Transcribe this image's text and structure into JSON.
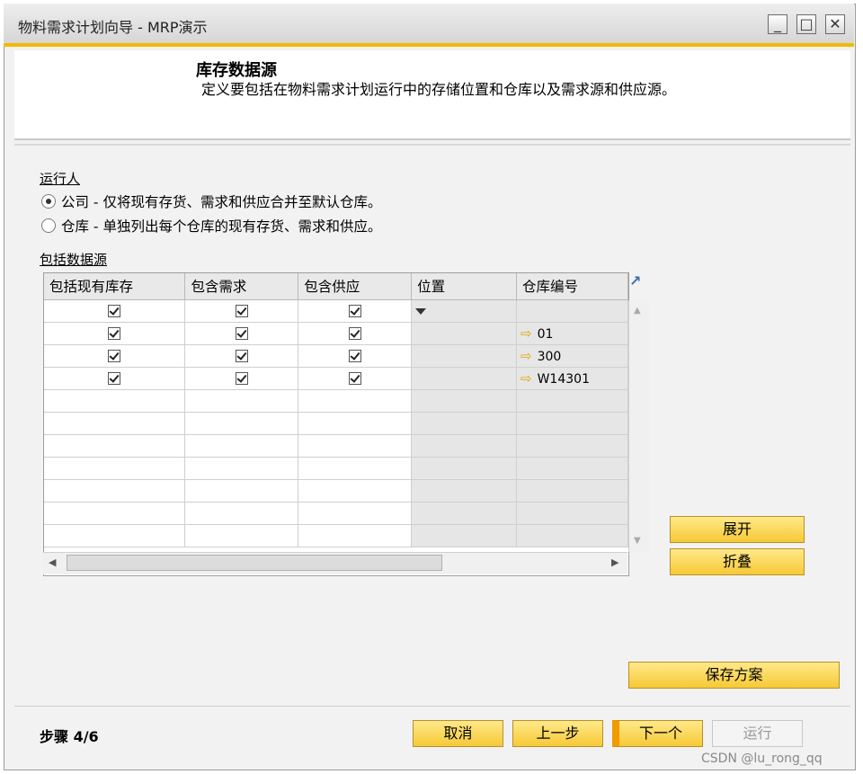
{
  "window": {
    "title": "物料需求计划向导 - MRP演示",
    "minimize": "_",
    "maximize": "□",
    "close": "✕"
  },
  "header": {
    "title": "库存数据源",
    "description": "定义要包括在物料需求计划运行中的存储位置和仓库以及需求源和供应源。"
  },
  "run_by": {
    "label": "运行人",
    "options": [
      {
        "label": "公司 - 仅将现有存货、需求和供应合并至默认仓库。",
        "selected": true
      },
      {
        "label": "仓库 - 单独列出每个仓库的现有存货、需求和供应。",
        "selected": false
      }
    ]
  },
  "include_sources": {
    "label": "包括数据源",
    "columns": [
      "包括现有库存",
      "包含需求",
      "包含供应",
      "位置",
      "仓库编号"
    ],
    "rows": [
      {
        "inv": true,
        "demand": true,
        "supply": true,
        "location": "",
        "warehouse": ""
      },
      {
        "inv": true,
        "demand": true,
        "supply": true,
        "location": "",
        "warehouse": "01"
      },
      {
        "inv": true,
        "demand": true,
        "supply": true,
        "location": "",
        "warehouse": "300"
      },
      {
        "inv": true,
        "demand": true,
        "supply": true,
        "location": "",
        "warehouse": "W14301"
      }
    ],
    "empty_rows": 7,
    "expander_icon": "expand-arrow-icon",
    "warehouse_link_icon": "arrow-right-icon",
    "link_color": "#e0a800"
  },
  "buttons": {
    "expand": "展开",
    "collapse": "折叠",
    "save_plan": "保存方案",
    "cancel": "取消",
    "back": "上一步",
    "next": "下一个",
    "run": "运行"
  },
  "footer": {
    "step": "步骤 4/6"
  },
  "watermark": "CSDN @lu_rong_qq",
  "colors": {
    "accent": "#f5b800",
    "button": "#f6c935"
  }
}
